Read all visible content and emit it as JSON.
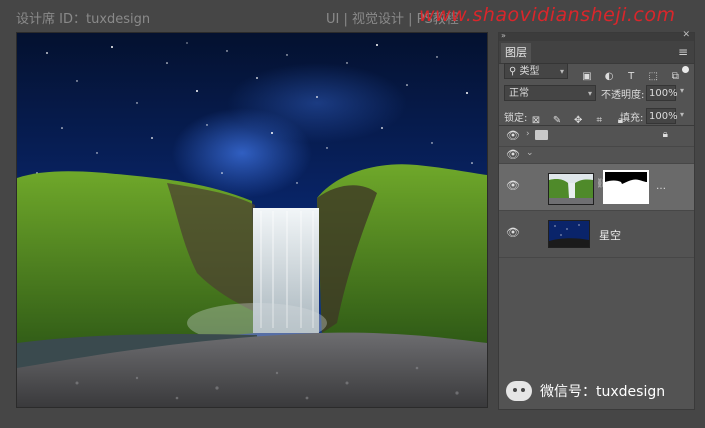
{
  "watermarks": {
    "top_left": "设计席 ID：tuxdesign",
    "top_mid": "UI | 视觉设计 | PS教程",
    "top_right": "www.shaovidiansheji.com",
    "bottom": "微信号：tuxdesign"
  },
  "layers_panel": {
    "tab_label": "图层",
    "filter_kind": "类型",
    "blend_mode": "正常",
    "opacity_label": "不透明度:",
    "opacity_value": "100%",
    "lock_label": "锁定:",
    "fill_label": "填充:",
    "fill_value": "100%",
    "layers": [
      {
        "type": "group",
        "visible": true,
        "locked": true
      },
      {
        "type": "group-expanded",
        "visible": true
      },
      {
        "type": "pixel",
        "name": "",
        "visible": true,
        "has_mask": true,
        "selected": true
      },
      {
        "type": "pixel",
        "name": "星空",
        "visible": true
      }
    ]
  }
}
